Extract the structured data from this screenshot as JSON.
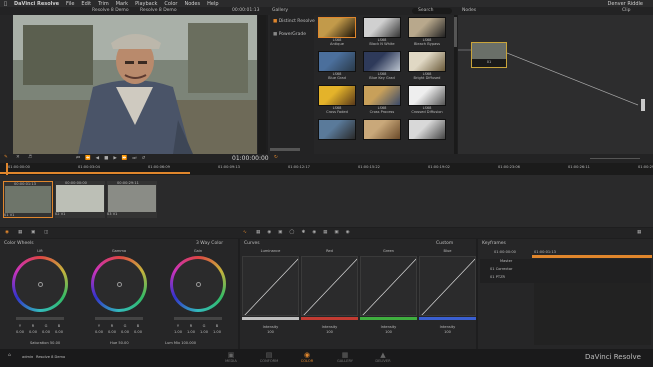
{
  "menubar": {
    "app": "DaVinci Resolve",
    "items": [
      "File",
      "Edit",
      "Trim",
      "Mark",
      "Playback",
      "Color",
      "Nodes",
      "Help"
    ],
    "right": "Denver Riddle"
  },
  "titlebar": {
    "project": "Resolve 8 Demo",
    "timeline": "Resolve 8 Demo",
    "timecode": "00:00:01:13",
    "gallery": "Gallery",
    "search": "Search",
    "nodes": "Nodes",
    "clip": "Clip"
  },
  "gallery": {
    "albums": [
      "Distinct Resolve",
      "PowerGrade"
    ],
    "stills": [
      {
        "code": "LS68",
        "name": "Antique"
      },
      {
        "code": "LS68",
        "name": "Black N White"
      },
      {
        "code": "LS68",
        "name": "Bleach Bypass"
      },
      {
        "code": "LS68",
        "name": "Blue Grad"
      },
      {
        "code": "LS68",
        "name": "Blue Key Grad"
      },
      {
        "code": "LS68",
        "name": "Bright Diffused"
      },
      {
        "code": "LS68",
        "name": "Cross Faded"
      },
      {
        "code": "LS68",
        "name": "Cross Process"
      },
      {
        "code": "LS68",
        "name": "Crossed Diffusion"
      },
      {
        "code": "",
        "name": ""
      },
      {
        "code": "",
        "name": ""
      },
      {
        "code": "",
        "name": ""
      }
    ]
  },
  "nodes": {
    "label": "01"
  },
  "transport": {
    "timecode": "01:00:00:00"
  },
  "ruler": [
    "01:00:00:00",
    "01:00:03:04",
    "01:00:06:09",
    "01:00:09:13",
    "01:00:12:17",
    "01:00:15:22",
    "01:00:19:02",
    "01:00:23:06",
    "01:00:26:11",
    "01:00:29:15"
  ],
  "clips": [
    {
      "tc": "00:00:01:13",
      "label": "01 V1"
    },
    {
      "tc": "00:00:00:00",
      "label": "02 V1"
    },
    {
      "tc": "00:00:29:11",
      "label": "03 V1"
    }
  ],
  "colorwheels": {
    "title": "Color Wheels",
    "mode": "3 Way Color",
    "wheels": [
      {
        "name": "Lift",
        "values": [
          "0.00",
          "0.00",
          "0.00",
          "0.00"
        ]
      },
      {
        "name": "Gamma",
        "values": [
          "0.00",
          "0.00",
          "0.00",
          "0.00"
        ]
      },
      {
        "name": "Gain",
        "values": [
          "1.00",
          "1.00",
          "1.00",
          "1.00"
        ]
      }
    ],
    "channels": [
      "Y",
      "R",
      "G",
      "B"
    ],
    "saturation": "Saturation 50.00",
    "hue": "Hue 50.00",
    "lummix": "Lum Mix 100.000"
  },
  "curves": {
    "title": "Curves",
    "preset": "Custom",
    "panels": [
      {
        "name": "Luminance",
        "color": "#bfbfbf",
        "intensity": "100"
      },
      {
        "name": "Red",
        "color": "#c23b32",
        "intensity": "100"
      },
      {
        "name": "Green",
        "color": "#3fae3f",
        "intensity": "100"
      },
      {
        "name": "Blue",
        "color": "#3a5fd0",
        "intensity": "100"
      }
    ],
    "intensity_label": "Intensity"
  },
  "keyframes": {
    "title": "Keyframes",
    "tc_start": "01:00:00:00",
    "tc_end": "01:00:01:13",
    "rows": [
      "Master",
      "01  Corrector",
      "01  PTZR"
    ]
  },
  "footer": {
    "user": "admin",
    "project": "Resolve 8 Demo",
    "tabs": [
      "MEDIA",
      "CONFORM",
      "COLOR",
      "GALLERY",
      "DELIVER"
    ],
    "brand": "DaVinci Resolve"
  },
  "colors": {
    "accent": "#e0862c",
    "bg": "#1e1e1f",
    "panel": "#262627"
  }
}
